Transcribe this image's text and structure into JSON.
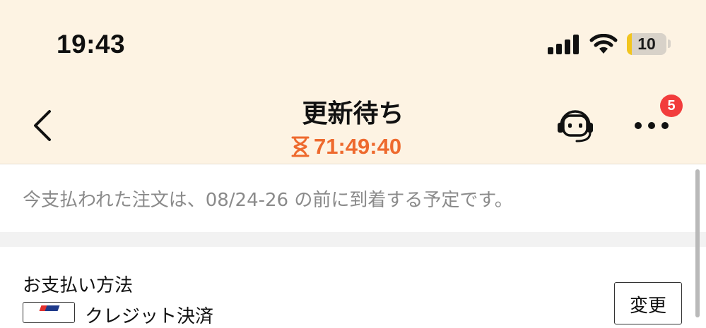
{
  "status_bar": {
    "time": "19:43",
    "battery_level": "10",
    "battery_fraction": 0.1
  },
  "header": {
    "title": "更新待ち",
    "countdown": "71:49:40",
    "notification_count": "5",
    "icons": {
      "back": "chevron-left-icon",
      "support": "headset-robot-icon",
      "more": "ellipsis-icon",
      "timer": "hourglass-icon"
    }
  },
  "notice": {
    "text": "今支払われた注文は、08/24-26 の前に到着する予定です。"
  },
  "payment": {
    "label": "お支払い方法",
    "change_label": "変更",
    "method_name": "クレジット決済"
  },
  "colors": {
    "header_bg": "#fdf3e3",
    "accent": "#ee6a2e",
    "badge": "#f23c3c",
    "battery": "#f2c51e"
  }
}
